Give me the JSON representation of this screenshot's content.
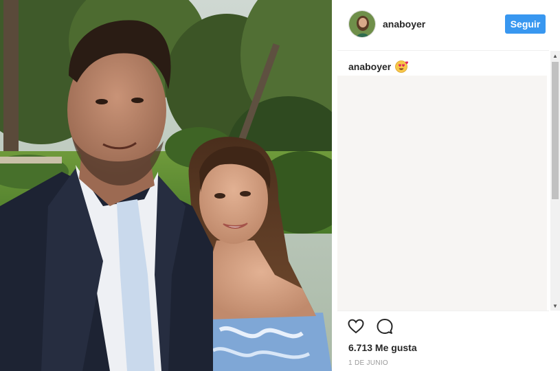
{
  "post": {
    "username": "anaboyer",
    "follow_label": "Seguir",
    "caption_username": "anaboyer",
    "caption_emoji": "heart-eyes-emoji",
    "likes": "6.713 Me gusta",
    "date": "1 DE JUNIO"
  },
  "icons": {
    "like": "heart-outline-icon",
    "comment": "comment-bubble-icon"
  },
  "colors": {
    "follow_button": "#3897f0",
    "comments_bg": "#f7f5f3",
    "divider": "#efefef"
  }
}
